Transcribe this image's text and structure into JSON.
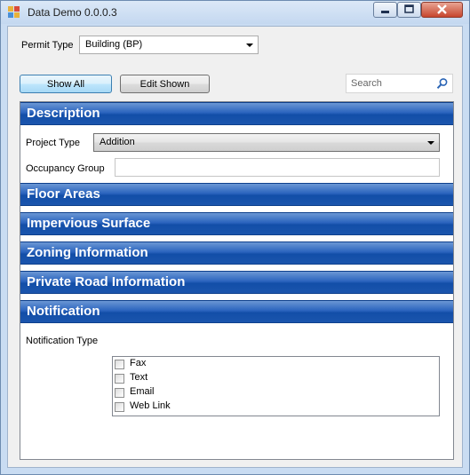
{
  "window": {
    "title": "Data Demo 0.0.0.3"
  },
  "permit": {
    "label": "Permit Type",
    "value": "Building (BP)"
  },
  "toolbar": {
    "show_all": "Show All",
    "edit_shown": "Edit Shown"
  },
  "search": {
    "placeholder": "Search"
  },
  "sections": {
    "description": "Description",
    "floor_areas": "Floor Areas",
    "impervious_surface": "Impervious Surface",
    "zoning_information": "Zoning Information",
    "private_road_information": "Private Road Information",
    "notification": "Notification"
  },
  "description": {
    "project_type_label": "Project Type",
    "project_type_value": "Addition",
    "occupancy_group_label": "Occupancy Group",
    "occupancy_group_value": ""
  },
  "notification": {
    "type_label": "Notification Type",
    "options": [
      {
        "label": "Fax",
        "checked": false
      },
      {
        "label": "Text",
        "checked": false
      },
      {
        "label": "Email",
        "checked": false
      },
      {
        "label": "Web Link",
        "checked": false
      }
    ]
  },
  "colors": {
    "section_header": "#2b64be",
    "window_frame": "#c9dcf2"
  },
  "icons": {
    "app": "app-icon",
    "search": "magnifier-icon",
    "minimize": "minimize-icon",
    "maximize": "maximize-icon",
    "close": "close-icon"
  }
}
